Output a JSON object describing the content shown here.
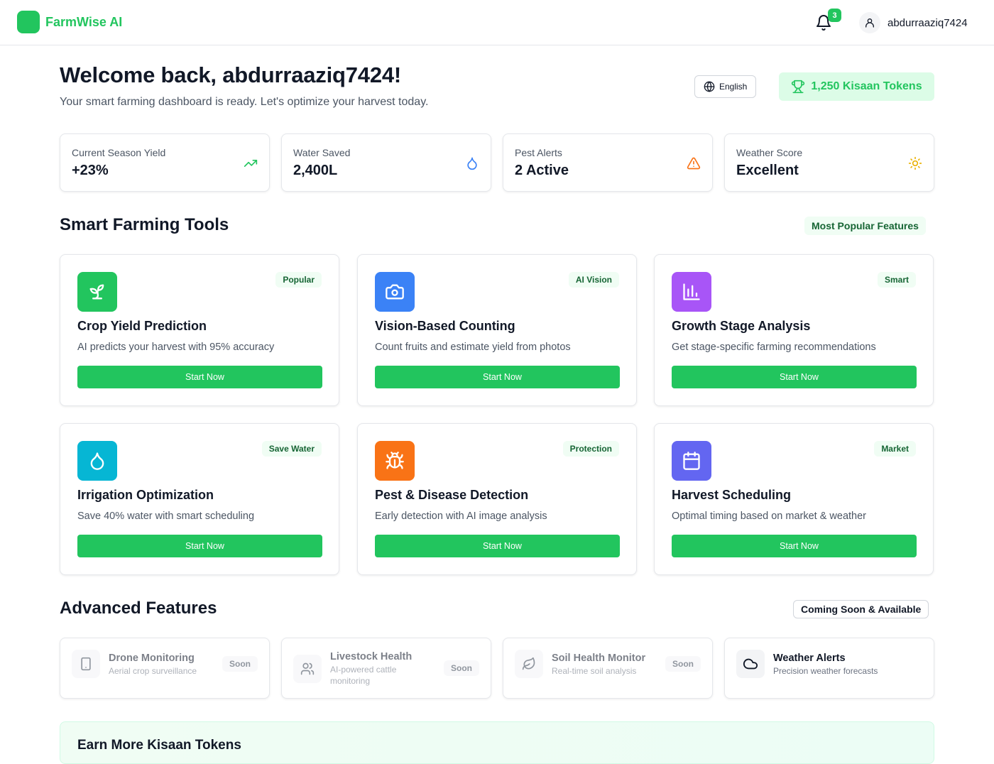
{
  "header": {
    "brand_glyph": "",
    "brand_name": "FarmWise AI",
    "notification_count": "3",
    "username": "abdurraaziq7424"
  },
  "welcome": {
    "title": "Welcome back, abdurraaziq7424! ",
    "subtitle": "Your smart farming dashboard is ready. Let's optimize your harvest today.",
    "language_label": " English",
    "tokens_label": "1,250 Kisaan Tokens"
  },
  "stats": [
    {
      "label": "Current Season Yield",
      "value": "+23%",
      "icon": "trending-up-icon",
      "color": "#22c55e"
    },
    {
      "label": "Water Saved",
      "value": "2,400L",
      "icon": "droplet-icon",
      "color": "#3b82f6"
    },
    {
      "label": "Pest Alerts",
      "value": "2 Active",
      "icon": "alert-triangle-icon",
      "color": "#f97316"
    },
    {
      "label": "Weather Score",
      "value": "Excellent",
      "icon": "sun-icon",
      "color": "#eab308"
    }
  ],
  "tools_section": {
    "title": "Smart Farming Tools",
    "pill": " Most Popular Features"
  },
  "tools": [
    {
      "title": "Crop Yield Prediction",
      "desc": "AI predicts your harvest with 95% accuracy",
      "badge": "Popular",
      "button": "Start Now",
      "button_glyph": "",
      "icon": "sprout-icon",
      "color": "#22c55e"
    },
    {
      "title": "Vision-Based Counting",
      "desc": "Count fruits and estimate yield from photos",
      "badge": "AI Vision",
      "button": "Start Now",
      "button_glyph": "",
      "icon": "camera-icon",
      "color": "#3b82f6"
    },
    {
      "title": "Growth Stage Analysis",
      "desc": "Get stage-specific farming recommendations",
      "badge": "Smart",
      "button": "Start Now",
      "button_glyph": "",
      "icon": "bar-chart-icon",
      "color": "#a855f7"
    },
    {
      "title": "Irrigation Optimization",
      "desc": "Save 40% water with smart scheduling",
      "badge": "Save Water",
      "button": "Start Now",
      "button_glyph": "",
      "icon": "droplet-icon",
      "color": "#06b6d4"
    },
    {
      "title": "Pest & Disease Detection",
      "desc": "Early detection with AI image analysis",
      "badge": "Protection",
      "button": "Start Now",
      "button_glyph": "",
      "icon": "bug-icon",
      "color": "#f97316"
    },
    {
      "title": "Harvest Scheduling",
      "desc": "Optimal timing based on market & weather",
      "badge": "Market",
      "button": "Start Now",
      "button_glyph": "",
      "icon": "calendar-icon",
      "color": "#6366f1"
    }
  ],
  "advanced_section": {
    "title": "Advanced Features",
    "pill": " Coming Soon & Available"
  },
  "advanced": [
    {
      "title": "Drone Monitoring",
      "desc": "Aerial crop surveillance",
      "status": "Soon",
      "icon": "tablet-icon"
    },
    {
      "title": "Livestock Health",
      "desc": "AI-powered cattle monitoring",
      "status": "Soon",
      "icon": "users-icon"
    },
    {
      "title": "Soil Health Monitor",
      "desc": "Real-time soil analysis",
      "status": "Soon",
      "icon": "leaf-icon"
    },
    {
      "title": "Weather Alerts",
      "desc": "Precision weather forecasts",
      "status": "",
      "icon": "cloud-icon"
    }
  ],
  "earn": {
    "title": " Earn More Kisaan Tokens"
  }
}
